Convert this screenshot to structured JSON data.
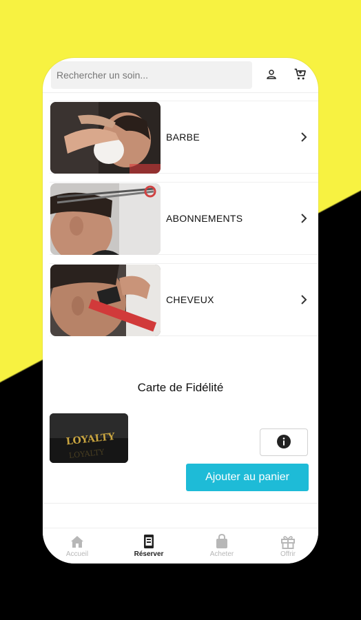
{
  "search": {
    "placeholder": "Rechercher un soin..."
  },
  "header": {
    "icons": [
      "user-icon",
      "cart-icon"
    ]
  },
  "categories": [
    {
      "label": "BARBE",
      "image": "beard-shave-photo"
    },
    {
      "label": "ABONNEMENTS",
      "image": "haircut-scissors-photo"
    },
    {
      "label": "CHEVEUX",
      "image": "hair-clipper-photo"
    }
  ],
  "loyalty": {
    "title": "Carte de Fidélité",
    "card_text": "LOYALTY",
    "card_text_reflection": "LOYALTY",
    "add_button": "Ajouter au panier"
  },
  "nav": {
    "items": [
      {
        "label": "Accueil",
        "icon": "home-icon",
        "active": false
      },
      {
        "label": "Réserver",
        "icon": "calendar-icon",
        "active": true
      },
      {
        "label": "Acheter",
        "icon": "bag-icon",
        "active": false
      },
      {
        "label": "Offrir",
        "icon": "gift-icon",
        "active": false
      }
    ]
  },
  "colors": {
    "accent": "#1ebbd7",
    "background_yellow": "#f7f241",
    "background_black": "#000000"
  }
}
